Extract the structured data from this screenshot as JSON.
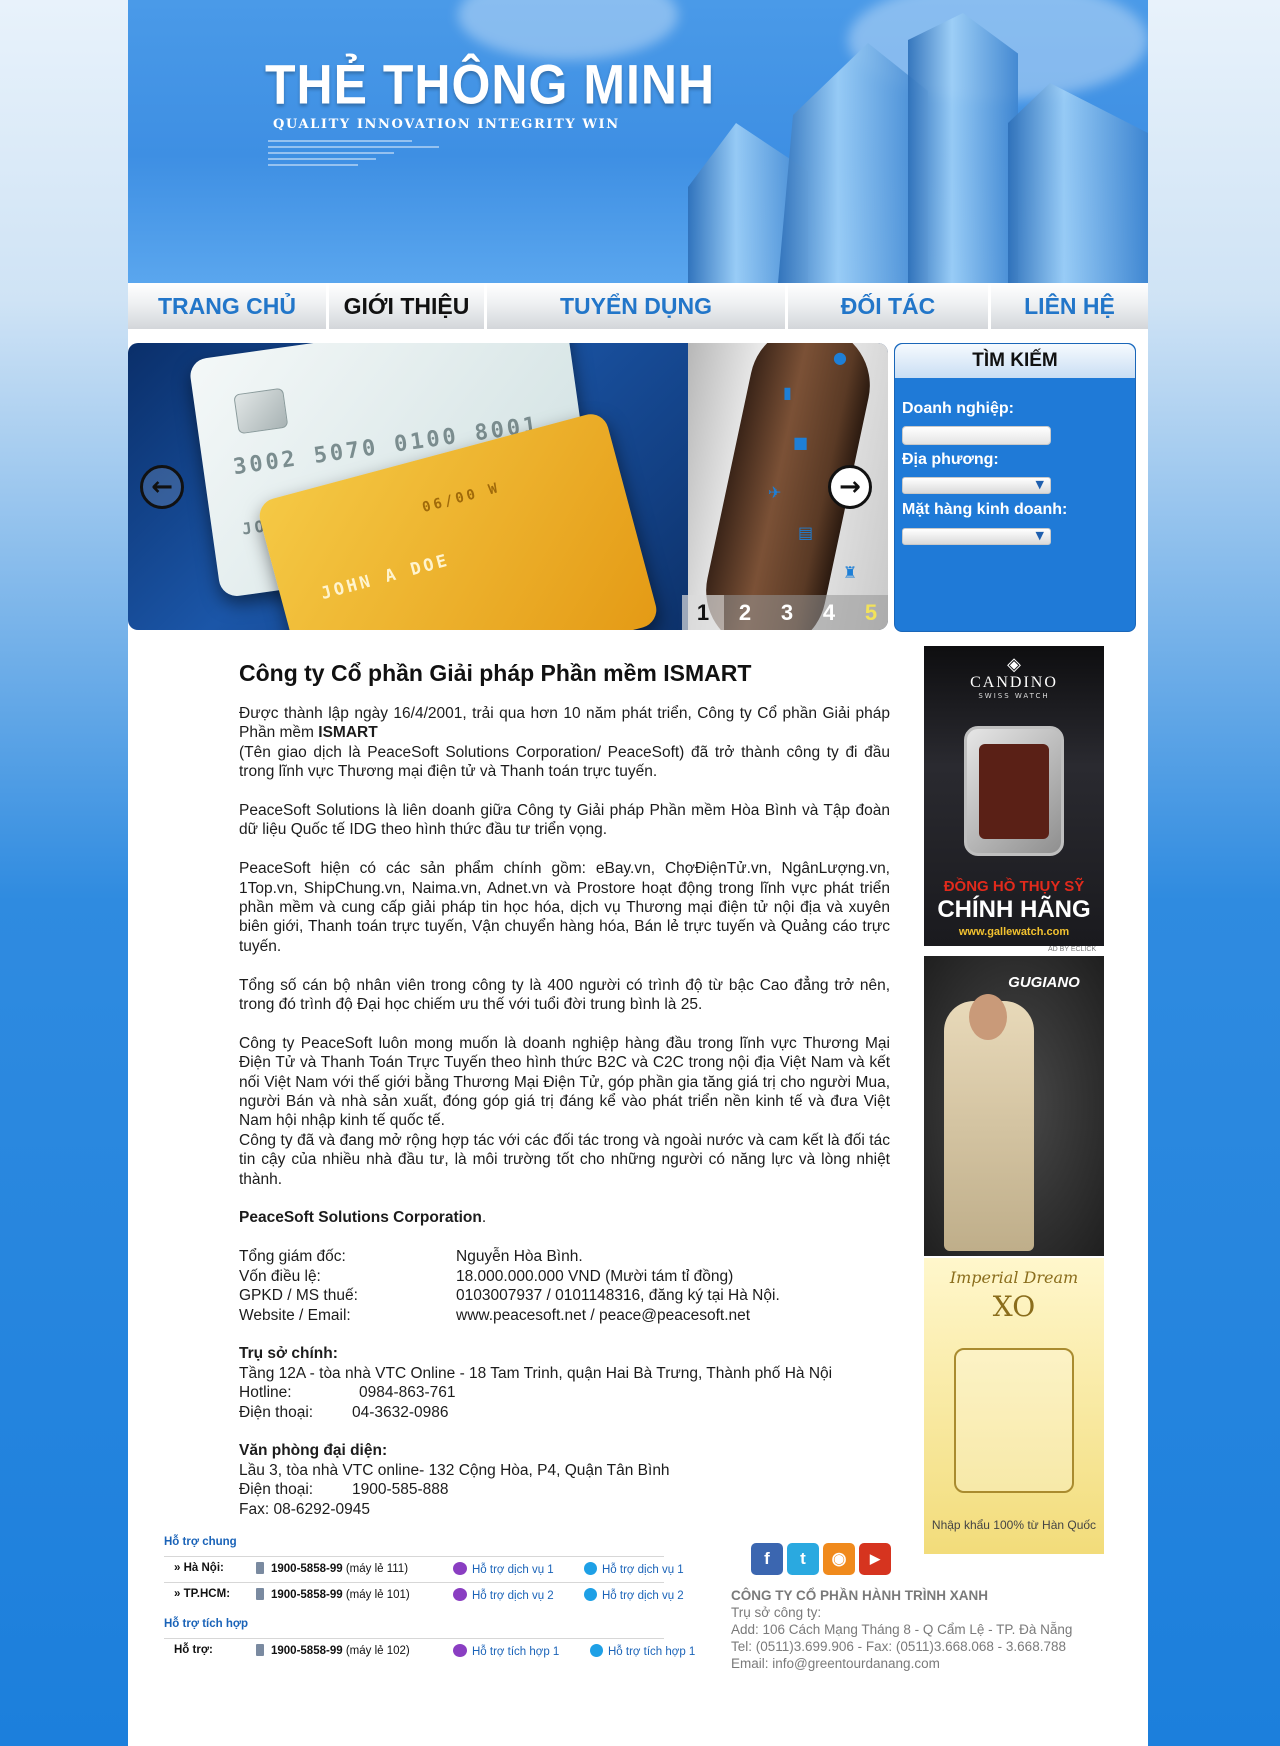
{
  "banner": {
    "title": "THẺ THÔNG MINH",
    "tagline": "QUALITY INNOVATION INTEGRITY WIN"
  },
  "nav": [
    {
      "label": "TRANG CHỦ"
    },
    {
      "label": "GIỚI THIỆU"
    },
    {
      "label": "TUYỂN DỤNG"
    },
    {
      "label": "ĐỐI TÁC"
    },
    {
      "label": "LIÊN HỆ"
    }
  ],
  "slider": {
    "card_white": {
      "number": "3002 5070 0100 8001",
      "expiry": "06/00 W",
      "name": "JOHN A DOE"
    },
    "card_gold": {
      "expiry": "06/00 W",
      "name": "JOHN A DOE"
    },
    "pages": [
      "1",
      "2",
      "3",
      "4",
      "5"
    ],
    "active_page": "1",
    "prev_icon": "arrow-left-icon",
    "next_icon": "arrow-right-icon"
  },
  "search": {
    "title": "TÌM KIẾM",
    "label_business": "Doanh nghiệp:",
    "label_locality": "Địa phương:",
    "label_goods": "Mặt hàng kinh doanh:"
  },
  "article": {
    "title": "Công ty Cổ phần Giải pháp Phần mềm ISMART",
    "p1_a": "Được thành lập ngày 16/4/2001, trải qua hơn 10 năm phát triển, Công ty Cổ phần Giải pháp Phần mềm ",
    "p1_b": "ISMART",
    "p1_c": "(Tên giao dịch là PeaceSoft Solutions Corporation/ PeaceSoft) đã trở thành công ty đi đầu trong lĩnh vực Thương mại điện tử và Thanh toán trực tuyến.",
    "p2": "PeaceSoft Solutions là liên doanh giữa Công ty Giải pháp Phần mềm Hòa Bình và Tập đoàn dữ liệu Quốc tế IDG theo hình thức đầu tư triển vọng.",
    "p3": "PeaceSoft hiện có các sản phẩm chính gồm: eBay.vn, ChợĐiệnTử.vn, NgânLượng.vn, 1Top.vn, ShipChung.vn, Naima.vn, Adnet.vn và Prostore hoạt động trong lĩnh vực phát triển phần mềm và cung cấp giải pháp tin học hóa, dịch vụ Thương mại điện tử nội địa và xuyên biên giới, Thanh toán trực tuyến, Vận chuyển hàng hóa, Bán lẻ trực tuyến và Quảng cáo trực tuyến.",
    "p4": "Tổng số cán bộ nhân viên trong công ty là 400 người có trình độ từ bậc Cao đẳng trở nên, trong đó trình độ Đại học chiếm ưu thế với tuổi đời trung bình là 25.",
    "p5": "Công ty PeaceSoft luôn mong muốn là doanh nghiệp hàng đầu trong lĩnh vực Thương Mại Điện Tử và Thanh Toán Trực Tuyến theo hình thức B2C và C2C trong nội địa Việt Nam và kết nối Việt Nam với thế giới bằng Thương Mại Điện Tử, góp phần gia tăng giá trị cho người Mua, người Bán và nhà sản xuất, đóng góp giá trị đáng kể vào phát triển nền kinh tế và đưa Việt Nam hội nhập kinh tế quốc tế.",
    "p6": "Công ty đã và đang mở rộng hợp tác với các đối tác trong và ngoài nước và cam kết là đối tác tin cậy của nhiều nhà đầu tư, là môi trường tốt cho những người có năng lực và lòng nhiệt thành.",
    "corp_name": "PeaceSoft Solutions Corporation",
    "corp_dot": ".",
    "info": [
      {
        "k": "Tổng giám đốc:",
        "v": "Nguyễn Hòa Bình."
      },
      {
        "k": "Vốn điều lệ:",
        "v": "18.000.000.000 VND (Mười tám tỉ đồng)"
      },
      {
        "k": "GPKD / MS thuế:",
        "v": "0103007937 / 0101148316, đăng ký tại Hà Nội."
      },
      {
        "k": "Website / Email:",
        "v": "www.peacesoft.net / peace@peacesoft.net"
      }
    ],
    "hq_title": "Trụ sở chính:",
    "hq_address": "Tầng 12A - tòa nhà VTC Online - 18 Tam Trinh, quận Hai Bà Trưng, Thành phố Hà Nội",
    "hq_hotline_k": "Hotline:",
    "hq_hotline_v": "0984-863-761",
    "hq_phone_k": "Điện thoại:",
    "hq_phone_v": "04-3632-0986",
    "rep_title": "Văn phòng đại diện:",
    "rep_address": "Lầu 3, tòa nhà VTC online- 132 Cộng Hòa, P4, Quận Tân Bình",
    "rep_phone_k": "Điện thoại:",
    "rep_phone_v": "1900-585-888",
    "rep_fax": "Fax: 08-6292-0945"
  },
  "ads": {
    "candino": {
      "brand": "CANDINO",
      "sub": "SWISS WATCH",
      "line1": "ĐỒNG HỒ THỤY SỸ",
      "line2": "CHÍNH HÃNG",
      "url": "www.gallewatch.com",
      "note": "AD BY ECLICK"
    },
    "gugiano": {
      "brand": "GUGIANO"
    },
    "xo": {
      "line1": "Imperial Dream",
      "line2": "XO",
      "bottom": "Nhập khẩu 100% từ Hàn Quốc"
    }
  },
  "support": {
    "general_title": "Hỗ trợ chung",
    "rows": [
      {
        "label": "» Hà Nội:",
        "phone": "1900-5858-99",
        "ext": "(máy lẻ 111)",
        "yahoo": "Hỗ trợ dịch vụ 1",
        "skype": "Hỗ trợ dịch vụ 1"
      },
      {
        "label": "» TP.HCM:",
        "phone": "1900-5858-99",
        "ext": "(máy lẻ 101)",
        "yahoo": "Hỗ trợ dịch vụ 2",
        "skype": "Hỗ trợ dịch vụ 2"
      }
    ],
    "integrated_title": "Hỗ trợ tích hợp",
    "integrated": {
      "label": "Hỗ trợ:",
      "phone": "1900-5858-99",
      "ext": "(máy lẻ 102)",
      "yahoo": "Hỗ trợ tích hợp 1",
      "skype": "Hỗ trợ tích hợp 1"
    }
  },
  "social": [
    {
      "icon": "facebook-icon",
      "glyph": "f",
      "color": "#3b66b0"
    },
    {
      "icon": "twitter-icon",
      "glyph": "t",
      "color": "#2aa9e0"
    },
    {
      "icon": "rss-icon",
      "glyph": "◉",
      "color": "#f08a1c"
    },
    {
      "icon": "youtube-icon",
      "glyph": "▶",
      "color": "#d6341f"
    }
  ],
  "company": {
    "name": "CÔNG TY CỔ PHẦN HÀNH TRÌNH XANH",
    "hq_label": "Trụ sở công ty:",
    "address": "Add: 106 Cách Mạng Tháng 8 - Q Cẩm Lệ - TP. Đà Nẵng",
    "phone": "Tel: (0511)3.699.906 - Fax: (0511)3.668.068 - 3.668.788",
    "email": "Email: info@greentourdanang.com"
  }
}
